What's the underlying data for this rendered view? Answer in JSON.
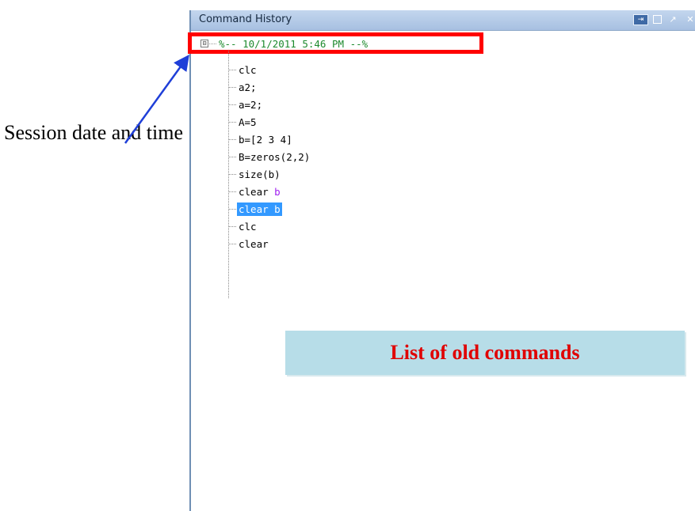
{
  "panel": {
    "title": "Command History",
    "session_header": "%-- 10/1/2011 5:46 PM --%",
    "collapse_symbol": "⊟",
    "controls": {
      "undock": "⇥",
      "close": "✕",
      "arrow": "↗"
    }
  },
  "commands": [
    {
      "text": "clc"
    },
    {
      "text": "a2;"
    },
    {
      "text": "a=2;"
    },
    {
      "text": "A=5"
    },
    {
      "text": "b=[2 3 4]"
    },
    {
      "text": "B=zeros(2,2)"
    },
    {
      "text": "size(b)"
    },
    {
      "text": "clear ",
      "arg": "b"
    },
    {
      "text": "clear b",
      "selected": true
    },
    {
      "text": "clc"
    },
    {
      "text": "clear"
    }
  ],
  "annotations": {
    "session_label": "Session date and time",
    "callout": "List of old commands"
  },
  "colors": {
    "highlight": "#ff0000",
    "session_text": "#1d8a2d",
    "selection": "#3399ff",
    "keyword_arg": "#a020f0",
    "callout_bg": "#b7dde8",
    "callout_text": "#e00000",
    "arrow": "#1f3fd8"
  }
}
